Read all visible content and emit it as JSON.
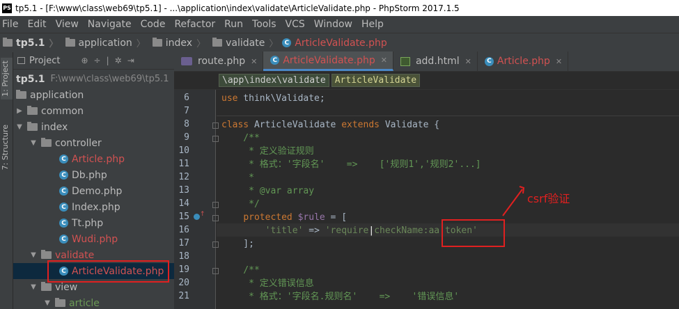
{
  "window": {
    "title": "tp5.1 - [F:\\www\\class\\web69\\tp5.1] - ...\\application\\index\\validate\\ArticleValidate.php - PhpStorm 2017.1.5",
    "logo_text": "PS"
  },
  "menu": [
    "File",
    "Edit",
    "View",
    "Navigate",
    "Code",
    "Refactor",
    "Run",
    "Tools",
    "VCS",
    "Window",
    "Help"
  ],
  "breadcrumb": [
    "tp5.1",
    "application",
    "index",
    "validate",
    "ArticleValidate.php"
  ],
  "toolstrip": {
    "project_tab": "1: Project",
    "structure_tab": "7: Structure"
  },
  "project_panel": {
    "title": "Project",
    "tree": [
      {
        "label": "tp5.1",
        "path": "F:\\www\\class\\web69\\tp5.1",
        "type": "root"
      },
      {
        "label": "application",
        "type": "folder",
        "expanded": true
      },
      {
        "label": "common",
        "type": "folder",
        "expanded": false
      },
      {
        "label": "index",
        "type": "folder",
        "expanded": true
      },
      {
        "label": "controller",
        "type": "folder",
        "expanded": true
      },
      {
        "label": "Article.php",
        "type": "php-class",
        "modified": true
      },
      {
        "label": "Db.php",
        "type": "php-class"
      },
      {
        "label": "Demo.php",
        "type": "php-class"
      },
      {
        "label": "Index.php",
        "type": "php-class"
      },
      {
        "label": "Tt.php",
        "type": "php-class"
      },
      {
        "label": "Wudi.php",
        "type": "php-class",
        "modified": true
      },
      {
        "label": "validate",
        "type": "folder",
        "expanded": true,
        "modified": true
      },
      {
        "label": "ArticleValidate.php",
        "type": "php-class",
        "modified": true,
        "selected": true
      },
      {
        "label": "view",
        "type": "folder",
        "expanded": true
      },
      {
        "label": "article",
        "type": "folder",
        "expanded": true,
        "green": true
      }
    ]
  },
  "tabs": [
    {
      "label": "route.php",
      "active": false,
      "modified": false
    },
    {
      "label": "ArticleValidate.php",
      "active": true,
      "modified": true
    },
    {
      "label": "add.html",
      "active": false,
      "modified": false
    },
    {
      "label": "Article.php",
      "active": false,
      "modified": true
    }
  ],
  "editor_breadcrumb": [
    "\\app\\index\\validate",
    "ArticleValidate"
  ],
  "code": {
    "line_numbers": [
      "6",
      "7",
      "8",
      "9",
      "10",
      "11",
      "12",
      "13",
      "14",
      "15",
      "16",
      "17",
      "18",
      "19",
      "20",
      "21"
    ],
    "l6_kw": "use",
    "l6_rest": " think\\Validate;",
    "l8_class": "class",
    "l8_name": " ArticleValidate ",
    "l8_extends": "extends",
    "l8_rest": " Validate {",
    "l9": "    /**",
    "l10": "     * 定义验证规则",
    "l11": "     * 格式：'字段名'    =>    ['规则1','规则2'...]",
    "l12": "     *",
    "l13_a": "     * ",
    "l13_tag": "@var",
    "l13_b": " array",
    "l14": "     */",
    "l15_kw": "protected",
    "l15_var": " $rule",
    "l15_rest": " = [",
    "l16_a": "        ",
    "l16_key": "'title'",
    "l16_arrow": " => ",
    "l16_val1": "'require",
    "l16_p1": "|",
    "l16_val2": "checkName:aa",
    "l16_p2": "|",
    "l16_val3": "token'",
    "l17": "    ];",
    "l19": "    /**",
    "l20": "     * 定义错误信息",
    "l21": "     * 格式：'字段名.规则名'    =>    '错误信息'"
  },
  "annotation": {
    "label": "csrf验证",
    "color": "#e02020"
  },
  "colors": {
    "keyword": "#cc7832",
    "string": "#6a8759",
    "variable": "#9876aa",
    "comment": "#629755",
    "modified": "#d25252",
    "accent": "#4a88c7"
  }
}
